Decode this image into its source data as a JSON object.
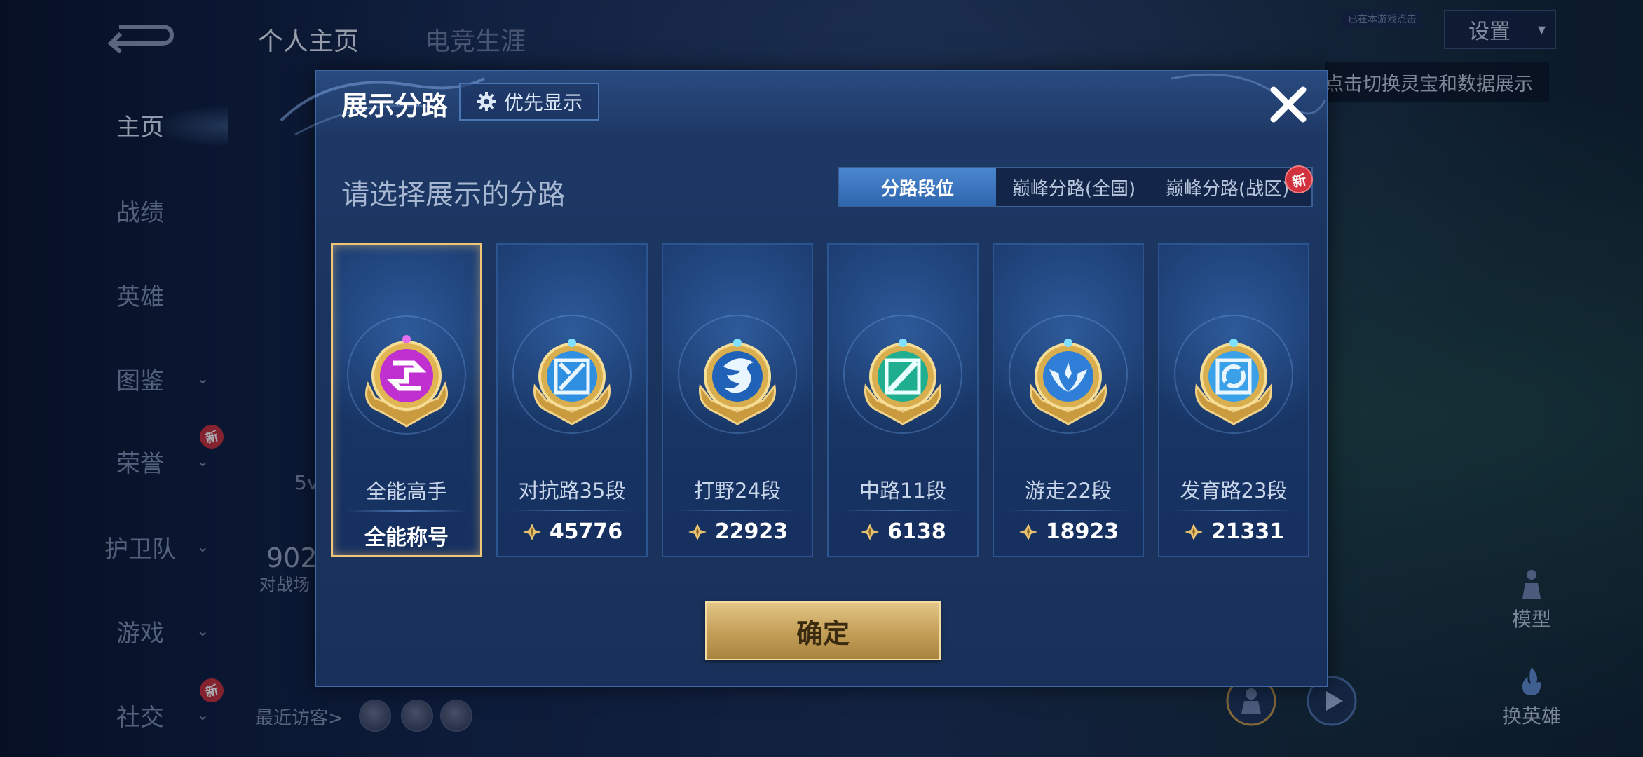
{
  "nav": {
    "items": [
      {
        "label": "主页",
        "active": true,
        "chevron": false,
        "new": false
      },
      {
        "label": "战绩",
        "active": false,
        "chevron": false,
        "new": false
      },
      {
        "label": "英雄",
        "active": false,
        "chevron": false,
        "new": false
      },
      {
        "label": "图鉴",
        "active": false,
        "chevron": true,
        "new": false
      },
      {
        "label": "荣誉",
        "active": false,
        "chevron": true,
        "new": true
      },
      {
        "label": "护卫队",
        "active": false,
        "chevron": true,
        "new": false
      },
      {
        "label": "游戏",
        "active": false,
        "chevron": true,
        "new": false
      },
      {
        "label": "社交",
        "active": false,
        "chevron": true,
        "new": true
      }
    ],
    "new_badge": "新"
  },
  "top_tabs": [
    "个人主页",
    "电竞生涯"
  ],
  "settings": {
    "label": "设置",
    "tiny_label": "已在本游戏点击"
  },
  "hint": "点击切换灵宝和数据展示",
  "background": {
    "fragment_5v": "5v",
    "fragment_902": "902",
    "fragment_duizhan": "对战场",
    "recent_visitors": "最近访客>",
    "model_label": "模型",
    "swap_hero_label": "换英雄"
  },
  "dialog": {
    "title": "展示分路",
    "priority_button": "优先显示",
    "subtitle": "请选择展示的分路",
    "segments": [
      "分路段位",
      "巅峰分路(全国)",
      "巅峰分路(战区)"
    ],
    "segment_new_badge": "新",
    "cards": [
      {
        "name": "全能高手",
        "score": "全能称号",
        "show_points_icon": false,
        "selected": true,
        "emblem": "all-round-emblem",
        "color": "#c02fd0"
      },
      {
        "name": "对抗路35段",
        "score": "45776",
        "show_points_icon": true,
        "selected": false,
        "emblem": "clash-lane-emblem",
        "color": "#2f8fe0"
      },
      {
        "name": "打野24段",
        "score": "22923",
        "show_points_icon": true,
        "selected": false,
        "emblem": "jungle-dragon-emblem",
        "color": "#1f62b8"
      },
      {
        "name": "中路11段",
        "score": "6138",
        "show_points_icon": true,
        "selected": false,
        "emblem": "mid-lane-emblem",
        "color": "#1fae8f"
      },
      {
        "name": "游走22段",
        "score": "18923",
        "show_points_icon": true,
        "selected": false,
        "emblem": "roam-wings-emblem",
        "color": "#2f7fd8"
      },
      {
        "name": "发育路23段",
        "score": "21331",
        "show_points_icon": true,
        "selected": false,
        "emblem": "farm-lane-emblem",
        "color": "#3aa0e8"
      }
    ],
    "confirm_button": "确定"
  },
  "colors": {
    "gold": "#f0c577",
    "accent_blue": "#3f7bc8",
    "new_badge": "#d2323e"
  }
}
